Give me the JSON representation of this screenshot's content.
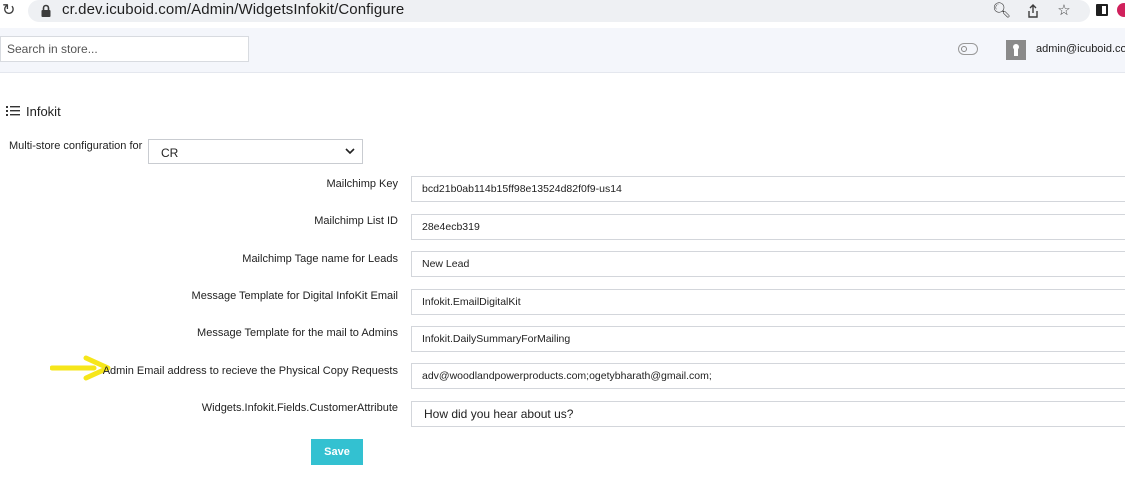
{
  "browser": {
    "url": "cr.dev.icuboid.com/Admin/WidgetsInfokit/Configure"
  },
  "header": {
    "search_placeholder": "Search in store...",
    "user_email": "admin@icuboid.com"
  },
  "page": {
    "title": "Infokit"
  },
  "multistore": {
    "label": "Multi-store configuration for",
    "selected": "CR"
  },
  "fields": [
    {
      "label": "Mailchimp Key",
      "value": "bcd21b0ab114b15ff98e13524d82f0f9-us14"
    },
    {
      "label": "Mailchimp List ID",
      "value": "28e4ecb319"
    },
    {
      "label": "Mailchimp Tage name for Leads",
      "value": "New Lead"
    },
    {
      "label": "Message Template for Digital InfoKit Email",
      "value": "Infokit.EmailDigitalKit"
    },
    {
      "label": "Message Template for the mail to Admins",
      "value": "Infokit.DailySummaryForMailing"
    },
    {
      "label": "Admin Email address to recieve the Physical Copy Requests",
      "value": "adv@woodlandpowerproducts.com;ogetybharath@gmail.com;"
    },
    {
      "label": "Widgets.Infokit.Fields.CustomerAttribute",
      "value": "How did you hear about us?"
    }
  ],
  "actions": {
    "save_label": "Save"
  },
  "colors": {
    "save_button": "#33c1d1",
    "annotation_arrow": "#f6e61a"
  }
}
